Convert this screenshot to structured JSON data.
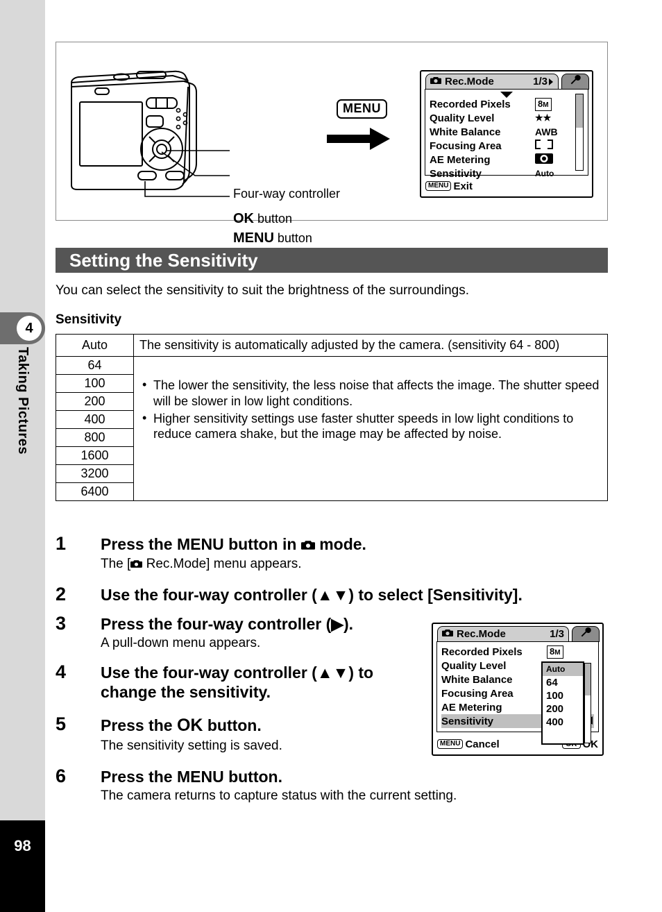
{
  "sidebar": {
    "chapter_number": "4",
    "chapter_label": "Taking Pictures",
    "page_number": "98"
  },
  "illustration": {
    "label_four_way": "Four-way controller",
    "label_ok_key": "OK",
    "label_ok_rest": " button",
    "label_menu_key": "MENU",
    "label_menu_rest": " button",
    "menu_chip": "MENU"
  },
  "lcd_top": {
    "tab_title": "Rec.Mode",
    "tab_page": "1/3",
    "rows": [
      {
        "name": "Recorded Pixels",
        "value": "8M"
      },
      {
        "name": "Quality Level",
        "value": "★★"
      },
      {
        "name": "White Balance",
        "value": "AWB"
      },
      {
        "name": "Focusing Area",
        "value": "[  ]"
      },
      {
        "name": "AE Metering",
        "value": "◉"
      },
      {
        "name": "Sensitivity",
        "value": "Auto"
      }
    ],
    "footer_key": "MENU",
    "footer_label": "Exit"
  },
  "lcd_bottom": {
    "tab_title": "Rec.Mode",
    "tab_page": "1/3",
    "rows": [
      {
        "name": "Recorded Pixels"
      },
      {
        "name": "Quality Level"
      },
      {
        "name": "White Balance"
      },
      {
        "name": "Focusing Area"
      },
      {
        "name": "AE Metering"
      },
      {
        "name": "Sensitivity"
      }
    ],
    "pixel_value": "8M",
    "dropdown_options": [
      "Auto",
      "64",
      "100",
      "200",
      "400"
    ],
    "dropdown_selected": "Auto",
    "footer_left_key": "MENU",
    "footer_left_label": "Cancel",
    "footer_right_key": "OK",
    "footer_right_label": "OK"
  },
  "section": {
    "title": "Setting the Sensitivity",
    "intro": "You can select the sensitivity to suit the brightness of the surroundings.",
    "subhead": "Sensitivity"
  },
  "table": {
    "auto_label": "Auto",
    "auto_desc": "The sensitivity is automatically adjusted by the camera. (sensitivity 64 - 800)",
    "values": [
      "64",
      "100",
      "200",
      "400",
      "800",
      "1600",
      "3200",
      "6400"
    ],
    "bullets": [
      "The lower the sensitivity, the less noise that affects the image. The shutter speed will be slower in low light conditions.",
      "Higher sensitivity settings use faster shutter speeds in low light conditions to reduce camera shake, but the image may be affected by noise."
    ]
  },
  "steps": [
    {
      "num": "1",
      "title_a": "Press the ",
      "title_key": "MENU",
      "title_b": " button in ",
      "title_c": " mode.",
      "desc_a": "The [",
      "desc_b": " Rec.Mode] menu appears."
    },
    {
      "num": "2",
      "title": "Use the four-way controller (▲▼) to select [Sensitivity]."
    },
    {
      "num": "3",
      "title": "Press the four-way controller (▶).",
      "desc": "A pull-down menu appears."
    },
    {
      "num": "4",
      "title": "Use the four-way controller (▲▼) to change the sensitivity."
    },
    {
      "num": "5",
      "title_a": "Press the ",
      "title_key": "OK",
      "title_b": " button.",
      "desc": "The sensitivity setting is saved."
    },
    {
      "num": "6",
      "title_a": "Press the ",
      "title_key": "MENU",
      "title_b": " button.",
      "desc": "The camera returns to capture status with the current setting."
    }
  ]
}
